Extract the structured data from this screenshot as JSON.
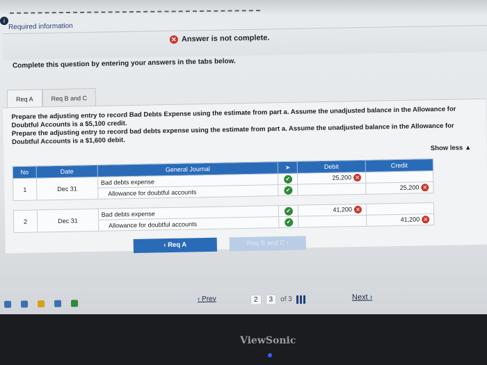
{
  "header": {
    "required_info": "Required information",
    "status_message": "Answer is not complete.",
    "instruction": "Complete this question by entering your answers in the tabs below."
  },
  "tabs": [
    {
      "label": "Req A"
    },
    {
      "label": "Req B and C"
    }
  ],
  "question": {
    "line1": "Prepare the adjusting entry to record Bad Debts Expense using the estimate from part a. Assume the unadjusted balance in the Allowance for Doubtful Accounts is a $5,100 credit.",
    "line2": "Prepare the adjusting entry to record bad debts expense using the estimate from part a. Assume the unadjusted balance in the Allowance for Doubtful Accounts is a $1,600 debit.",
    "show_less": "Show less"
  },
  "journal": {
    "headers": {
      "no": "No",
      "date": "Date",
      "general_journal": "General Journal",
      "debit": "Debit",
      "credit": "Credit"
    },
    "entries": [
      {
        "no": "1",
        "date": "Dec 31",
        "debit_account": "Bad debts expense",
        "credit_account": "Allowance for doubtful accounts",
        "debit": "25,200",
        "credit": "25,200"
      },
      {
        "no": "2",
        "date": "Dec 31",
        "debit_account": "Bad debts expense",
        "credit_account": "Allowance for doubtful accounts",
        "debit": "41,200",
        "credit": "41,200"
      }
    ]
  },
  "nav": {
    "prev_tab": "Req A",
    "next_tab": "Req B and C"
  },
  "pager": {
    "prev": "Prev",
    "page_a": "2",
    "page_b": "3",
    "of_total": "of 3",
    "next": "Next"
  },
  "monitor": {
    "brand": "ViewSonic"
  }
}
